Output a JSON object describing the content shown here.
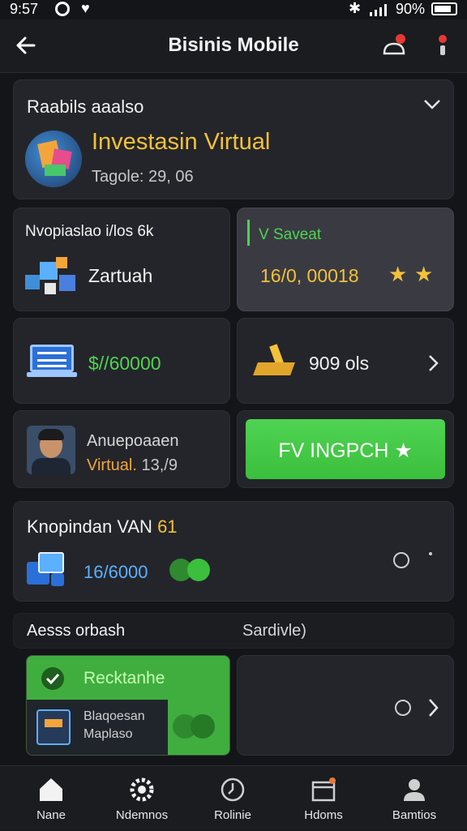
{
  "status": {
    "time": "9:57",
    "battery": "90%"
  },
  "header": {
    "title": "Bisinis Mobile"
  },
  "featured": {
    "section_title": "Raabils aaalso",
    "title": "Investasin Virtual",
    "subtitle": "Tagole: 29, 06"
  },
  "grid": {
    "card1": {
      "label": "Nvopiaslao i/los 6k",
      "title": "Zartuah"
    },
    "card2": {
      "label": "V Saveat",
      "value": "16/0, 00018"
    },
    "card3": {
      "value": "$//60000"
    },
    "card4": {
      "value": "909 ols"
    },
    "card5": {
      "line1": "Anuepoaaen",
      "line2_a": "Virtual.",
      "line2_b": "13,/9"
    },
    "card6": {
      "button_label": "FV INGPCH"
    }
  },
  "knopindan": {
    "title": "Knopindan VAN",
    "badge": "61",
    "value": "16/6000"
  },
  "section2": {
    "left_label": "Aesss orbash",
    "right_label": "Sardivle)"
  },
  "promo": {
    "title": "Recktanhe",
    "line1": "Blaqoesan",
    "line2": "Maplaso"
  },
  "nav": {
    "items": [
      "Nane",
      "Ndemnos",
      "Rolinie",
      "Hdoms",
      "Bamtios"
    ]
  },
  "colors": {
    "accent_green": "#4fd352",
    "gold": "#f3c13a",
    "background": "#141518"
  }
}
